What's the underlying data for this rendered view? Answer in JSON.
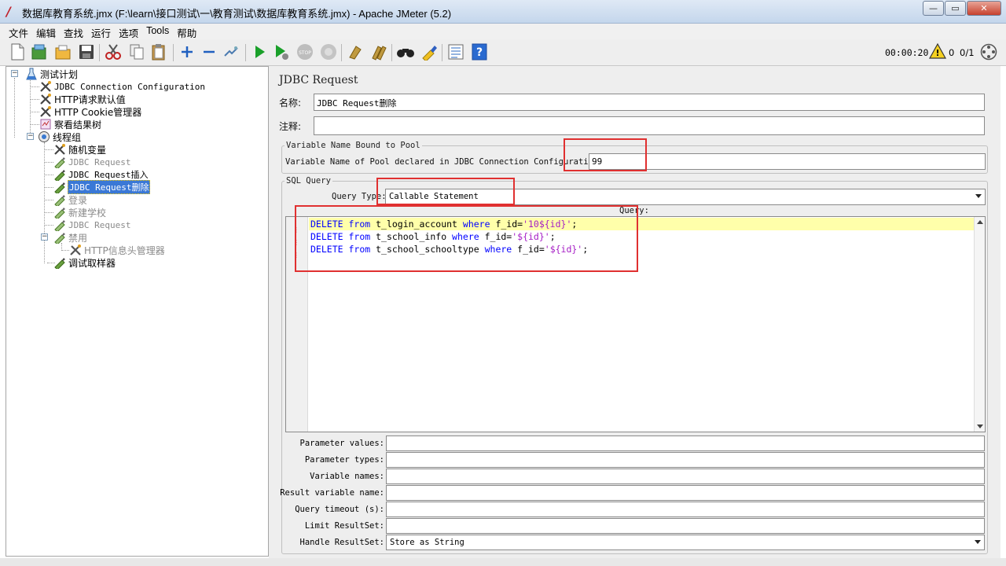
{
  "window": {
    "title": "数据库教育系统.jmx (F:\\learn\\接口测试\\一\\教育测试\\数据库教育系统.jmx) - Apache JMeter (5.2)",
    "minimize": "—",
    "maximize": "▭",
    "close": "✕"
  },
  "menu": [
    "文件",
    "编辑",
    "查找",
    "运行",
    "选项",
    "Tools",
    "帮助"
  ],
  "toolbar": {
    "timer": "00:00:20",
    "error_count": "0",
    "threads": "0/1"
  },
  "tree": {
    "nodes": [
      {
        "label": "测试计划",
        "icon": "test-plan-icon"
      },
      {
        "label": "JDBC Connection Configuration",
        "icon": "config-icon"
      },
      {
        "label": "HTTP请求默认值",
        "icon": "config-icon"
      },
      {
        "label": "HTTP Cookie管理器",
        "icon": "config-icon"
      },
      {
        "label": "察看结果树",
        "icon": "listener-icon"
      },
      {
        "label": "线程组",
        "icon": "thread-group-icon"
      },
      {
        "label": "随机变量",
        "icon": "config-icon"
      },
      {
        "label": "JDBC Request",
        "icon": "sampler-icon"
      },
      {
        "label": "JDBC Request插入",
        "icon": "sampler-icon"
      },
      {
        "label": "JDBC Request删除",
        "icon": "sampler-icon"
      },
      {
        "label": "登录",
        "icon": "sampler-icon"
      },
      {
        "label": "新建学校",
        "icon": "sampler-icon"
      },
      {
        "label": "JDBC Request",
        "icon": "sampler-icon"
      },
      {
        "label": "禁用",
        "icon": "sampler-icon"
      },
      {
        "label": "HTTP信息头管理器",
        "icon": "config-icon"
      },
      {
        "label": "调试取样器",
        "icon": "sampler-icon"
      }
    ]
  },
  "panel": {
    "title": "JDBC Request",
    "name_label": "名称:",
    "name_value": "JDBC Request删除",
    "comment_label": "注释:",
    "comment_value": "",
    "pool_group_title": "Variable Name Bound to Pool",
    "pool_label": "Variable Name of Pool declared in JDBC Connection Configuration:",
    "pool_value": "99",
    "sql_group_title": "SQL Query",
    "query_type_label": "Query Type:",
    "query_type_value": "Callable Statement",
    "query_label": "Query:",
    "sql": {
      "line1": {
        "kw1": "DELETE",
        "kw2": "from",
        "table": " t_login_account ",
        "kw3": "where",
        "col": " f_id=",
        "val": "'10${id}'",
        "end": ";"
      },
      "line2": {
        "kw1": "DELETE",
        "kw2": "from",
        "table": " t_school_info ",
        "kw3": "where",
        "col": " f_id=",
        "val": "'${id}'",
        "end": ";"
      },
      "line3": {
        "kw1": "DELETE",
        "kw2": "from",
        "table": " t_school_schooltype ",
        "kw3": "where",
        "col": " f_id=",
        "val": "'${id}'",
        "end": ";"
      }
    },
    "params": [
      {
        "label": "Parameter values:",
        "value": ""
      },
      {
        "label": "Parameter types:",
        "value": ""
      },
      {
        "label": "Variable names:",
        "value": ""
      },
      {
        "label": "Result variable name:",
        "value": ""
      },
      {
        "label": "Query timeout (s):",
        "value": ""
      },
      {
        "label": "Limit ResultSet:",
        "value": ""
      }
    ],
    "handle_resultset_label": "Handle ResultSet:",
    "handle_resultset_value": "Store as String"
  },
  "colors": {
    "selection": "#3a78d6",
    "highlight_line": "#ffffaa",
    "annotation_red": "#e03030",
    "keyword": "#0000ff",
    "string": "#a51cc5"
  }
}
